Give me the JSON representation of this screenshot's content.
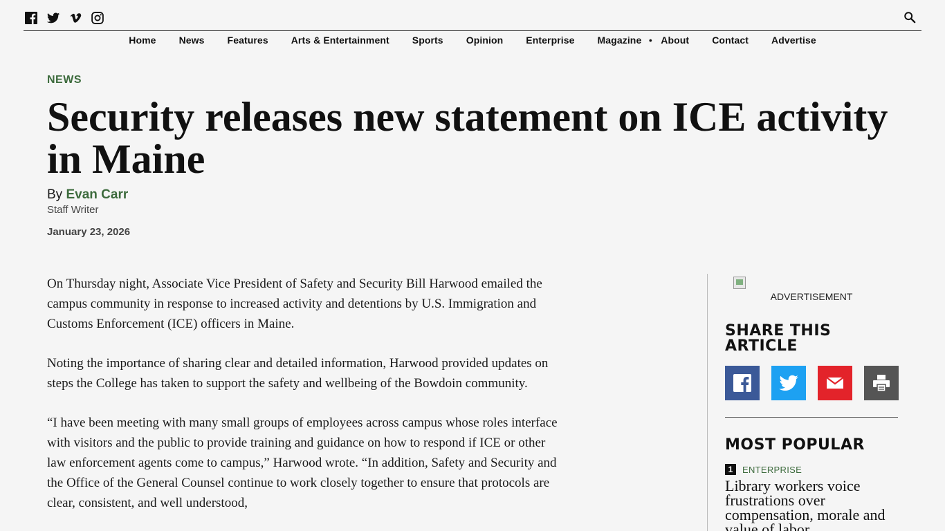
{
  "social": {
    "icons": [
      "facebook-icon",
      "twitter-icon",
      "vimeo-icon",
      "instagram-icon"
    ],
    "search_icon": "search-icon"
  },
  "nav": {
    "items": [
      "Home",
      "News",
      "Features",
      "Arts & Entertainment",
      "Sports",
      "Opinion",
      "Enterprise",
      "Magazine",
      "About",
      "Contact",
      "Advertise"
    ],
    "separator": "•"
  },
  "article": {
    "kicker": "NEWS",
    "headline": "Security releases new statement on ICE activity in Maine",
    "by_prefix": "By",
    "author": "Evan Carr",
    "author_role": "Staff Writer",
    "date": "January 23, 2026",
    "paragraphs": [
      "On Thursday night, Associate Vice President of Safety and Security Bill Harwood emailed the campus community in response to increased activity and detentions by U.S. Immigration and Customs Enforcement (ICE) officers in Maine.",
      "Noting the importance of sharing clear and detailed information, Harwood provided updates on steps the College has taken to support the safety and wellbeing of the Bowdoin community.",
      "“I have been meeting with many small groups of employees across campus whose roles interface with visitors and the public to provide training and guidance on how to respond if ICE or other law enforcement agents come to campus,” Harwood wrote. “In addition, Safety and Security and the Office of the General Counsel continue to work closely together to ensure that protocols are clear, consistent, and well understood,"
    ]
  },
  "sidebar": {
    "ad_label": "ADVERTISEMENT",
    "share_title": "SHARE THIS ARTICLE",
    "share_buttons": [
      "facebook-icon",
      "twitter-icon",
      "email-icon",
      "print-icon"
    ],
    "popular_title": "MOST POPULAR",
    "popular": [
      {
        "rank": "1",
        "category": "ENTERPRISE",
        "headline": "Library workers voice frustrations over compensation, morale and value of labor"
      }
    ]
  },
  "colors": {
    "accent_green": "#3d6b3d",
    "facebook": "#3b5998",
    "twitter": "#1da1f2",
    "email": "#e3232a",
    "print": "#555555",
    "background": "#f5f5f5"
  }
}
